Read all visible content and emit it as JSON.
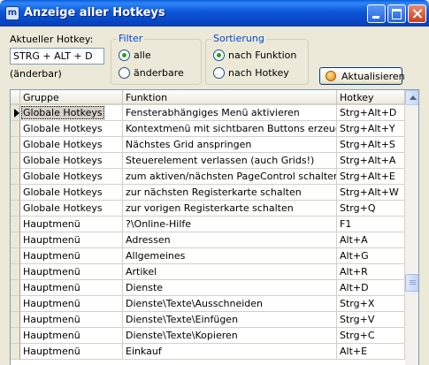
{
  "window": {
    "title": "Anzeige aller Hotkeys",
    "app_icon": "m"
  },
  "current_hotkey": {
    "label": "Aktueller Hotkey:",
    "value": "STRG + ALT + D",
    "note": "(änderbar)"
  },
  "filter": {
    "title": "Filter",
    "options": [
      {
        "label": "alle",
        "selected": true
      },
      {
        "label": "änderbare",
        "selected": false
      }
    ]
  },
  "sort": {
    "title": "Sortierung",
    "options": [
      {
        "label": "nach Funktion",
        "selected": true
      },
      {
        "label": "nach Hotkey",
        "selected": false
      }
    ]
  },
  "refresh_button": {
    "label": "Aktualisieren",
    "icon": "refresh-icon"
  },
  "grid": {
    "columns": [
      "Gruppe",
      "Funktion",
      "Hotkey"
    ],
    "current_row_index": 0,
    "rows": [
      [
        "Globale Hotkeys",
        "Fensterabhängiges Menü aktivieren",
        "Strg+Alt+D"
      ],
      [
        "Globale Hotkeys",
        "Kontextmenü mit sichtbaren Buttons erzeugen",
        "Strg+Alt+Y"
      ],
      [
        "Globale Hotkeys",
        "Nächstes Grid anspringen",
        "Strg+Alt+S"
      ],
      [
        "Globale Hotkeys",
        "Steuerelement verlassen (auch Grids!)",
        "Strg+Alt+A"
      ],
      [
        "Globale Hotkeys",
        "zum aktiven/nächsten PageControl schalten",
        "Strg+Alt+E"
      ],
      [
        "Globale Hotkeys",
        "zur nächsten Registerkarte schalten",
        "Strg+Alt+W"
      ],
      [
        "Globale Hotkeys",
        "zur vorigen Registerkarte schalten",
        "Strg+Q"
      ],
      [
        "Hauptmenü",
        "?\\Online-Hilfe",
        "F1"
      ],
      [
        "Hauptmenü",
        "Adressen",
        "Alt+A"
      ],
      [
        "Hauptmenü",
        "Allgemeines",
        "Alt+G"
      ],
      [
        "Hauptmenü",
        "Artikel",
        "Alt+R"
      ],
      [
        "Hauptmenü",
        "Dienste",
        "Alt+D"
      ],
      [
        "Hauptmenü",
        "Dienste\\Texte\\Ausschneiden",
        "Strg+X"
      ],
      [
        "Hauptmenü",
        "Dienste\\Texte\\Einfügen",
        "Strg+V"
      ],
      [
        "Hauptmenü",
        "Dienste\\Texte\\Kopieren",
        "Strg+C"
      ],
      [
        "Hauptmenü",
        "Einkauf",
        "Alt+E"
      ]
    ]
  }
}
